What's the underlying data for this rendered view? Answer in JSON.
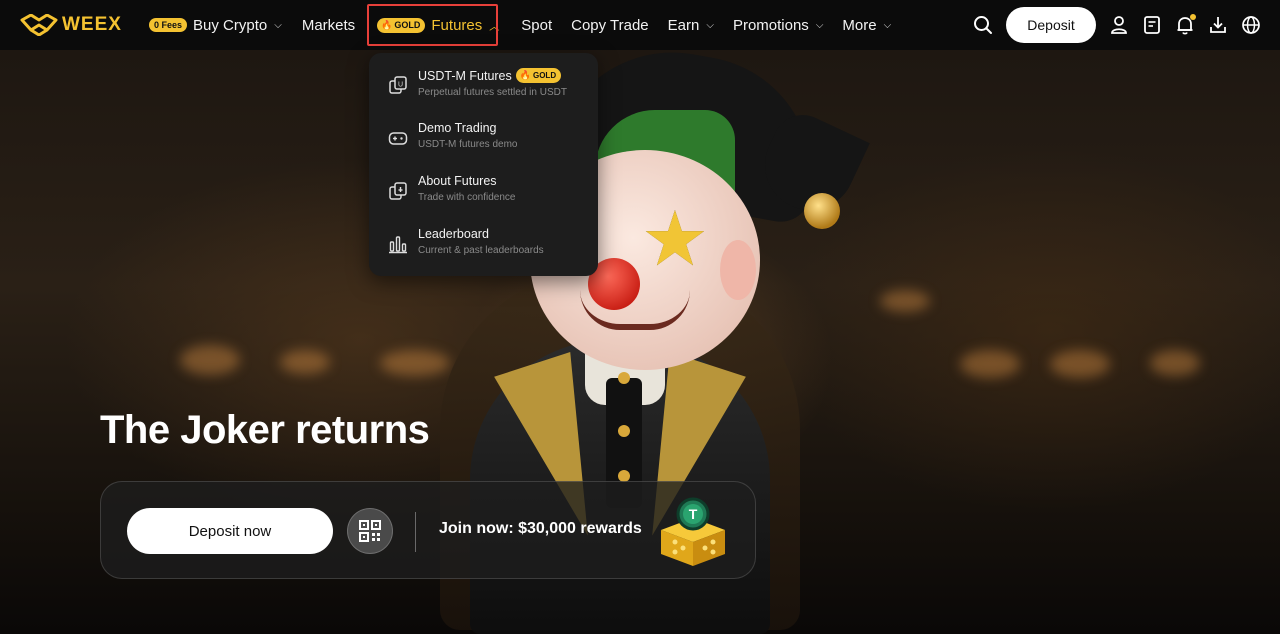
{
  "brand": {
    "name": "WEEX"
  },
  "nav": {
    "items": [
      {
        "id": "buy-crypto",
        "badge": "0 Fees",
        "label": "Buy Crypto",
        "has_chevron": true
      },
      {
        "id": "markets",
        "label": "Markets"
      },
      {
        "id": "futures",
        "badge": "GOLD",
        "label": "Futures",
        "has_chevron": true,
        "open": true
      },
      {
        "id": "spot",
        "label": "Spot"
      },
      {
        "id": "copy-trade",
        "label": "Copy Trade"
      },
      {
        "id": "earn",
        "label": "Earn",
        "has_chevron": true
      },
      {
        "id": "promotions",
        "label": "Promotions",
        "has_chevron": true
      },
      {
        "id": "more",
        "label": "More",
        "has_chevron": true
      }
    ],
    "deposit_label": "Deposit",
    "right_icons": [
      "search-icon",
      "user-icon",
      "orders-icon",
      "bell-icon",
      "download-icon",
      "globe-icon"
    ]
  },
  "futures_menu": [
    {
      "title": "USDT-M Futures",
      "badge": "GOLD",
      "subtitle": "Perpetual futures settled in USDT",
      "icon": "usdt-futures-icon"
    },
    {
      "title": "Demo Trading",
      "subtitle": "USDT-M futures demo",
      "icon": "gamepad-icon"
    },
    {
      "title": "About Futures",
      "subtitle": "Trade with confidence",
      "icon": "futures-info-icon"
    },
    {
      "title": "Leaderboard",
      "subtitle": "Current & past leaderboards",
      "icon": "bar-chart-icon"
    }
  ],
  "hero": {
    "headline": "The Joker returns",
    "deposit_now": "Deposit now",
    "promo_text": "Join now: $30,000 rewards"
  },
  "colors": {
    "accent": "#f4c231",
    "highlight_border": "#e8403a",
    "nav_bg": "#0b0b0b",
    "dropdown_bg": "#1d1d1d"
  }
}
